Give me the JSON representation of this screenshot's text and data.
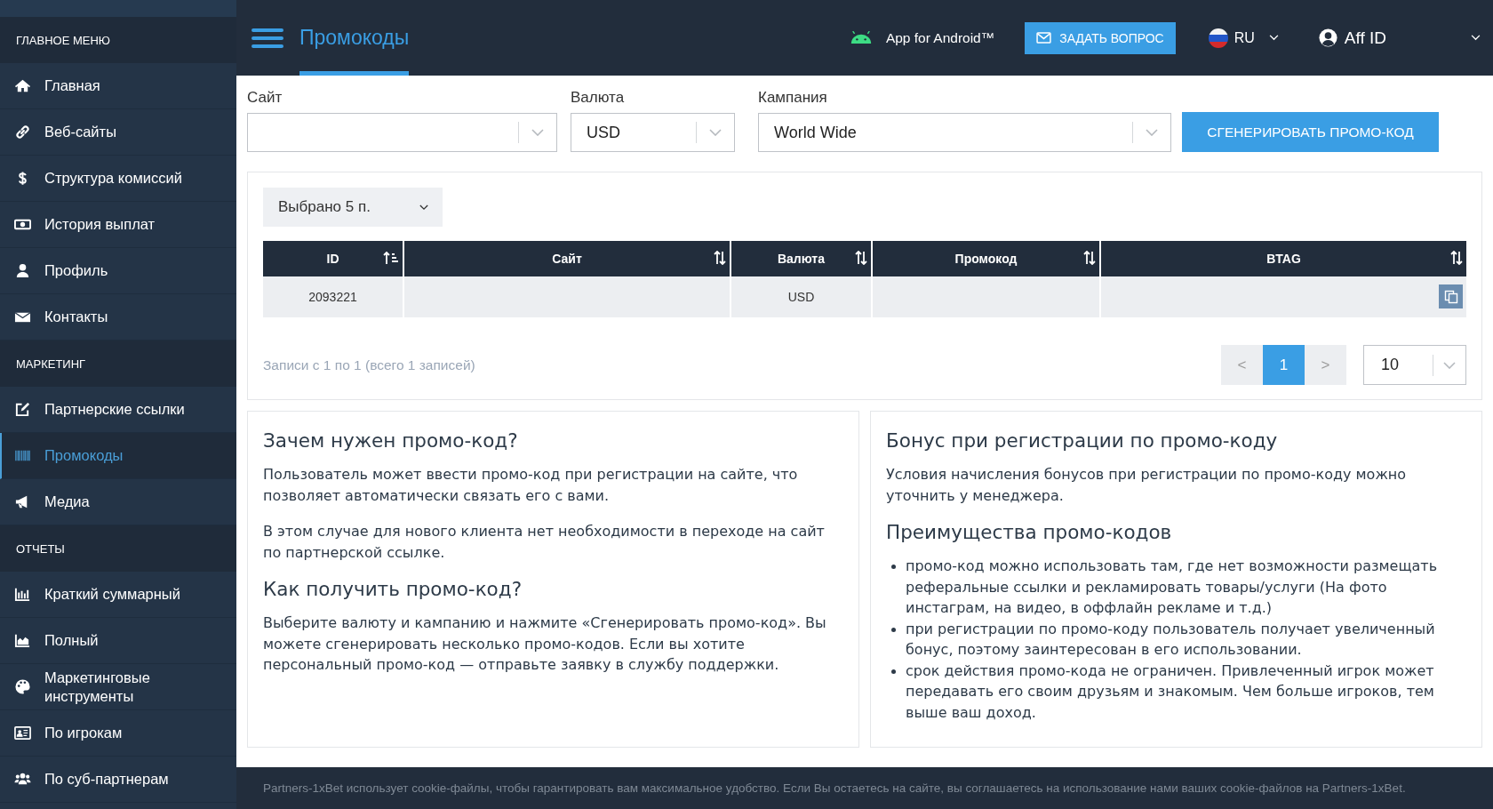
{
  "sidebar": {
    "sections": [
      {
        "title": "ГЛАВНОЕ МЕНЮ",
        "items": [
          {
            "label": "Главная",
            "kind": "home",
            "selected": false
          },
          {
            "label": "Веб-сайты",
            "kind": "link",
            "selected": false
          },
          {
            "label": "Структура комиссий",
            "kind": "dollar",
            "selected": false
          },
          {
            "label": "История выплат",
            "kind": "money",
            "selected": false
          },
          {
            "label": "Профиль",
            "kind": "user",
            "selected": false
          },
          {
            "label": "Контакты",
            "kind": "mail",
            "selected": false
          }
        ]
      },
      {
        "title": "МАРКЕТИНГ",
        "items": [
          {
            "label": "Партнерские ссылки",
            "kind": "edit",
            "selected": false
          },
          {
            "label": "Промокоды",
            "kind": "barcode",
            "selected": true
          },
          {
            "label": "Медиа",
            "kind": "megaphone",
            "selected": false
          }
        ]
      },
      {
        "title": "ОТЧЕТЫ",
        "items": [
          {
            "label": "Краткий суммарный",
            "kind": "bars",
            "selected": false
          },
          {
            "label": "Полный",
            "kind": "area",
            "selected": false
          },
          {
            "label": "Маркетинговые инструменты",
            "kind": "palette",
            "selected": false
          },
          {
            "label": "По игрокам",
            "kind": "card",
            "selected": false
          },
          {
            "label": "По суб-партнерам",
            "kind": "users",
            "selected": false
          }
        ]
      }
    ]
  },
  "header": {
    "title": "Промокоды",
    "app_link": "App for Android™",
    "ask_button": "ЗАДАТЬ ВОПРОС",
    "language": "RU",
    "user": "Aff ID"
  },
  "filters": [
    {
      "label": "Сайт"
    },
    {
      "label": "Валюта",
      "value": "USD"
    },
    {
      "label": "Кампания",
      "value": "World Wide"
    }
  ],
  "generate_button": "СГЕНЕРИРОВАТЬ ПРОМО-КОД",
  "table": {
    "column_selector": "Выбрано 5 п.",
    "columns": [
      {
        "label": "ID",
        "sorted": true
      },
      {
        "label": "Сайт",
        "sorted": false
      },
      {
        "label": "Валюта",
        "sorted": false
      },
      {
        "label": "Промокод",
        "sorted": false
      },
      {
        "label": "BTAG",
        "sorted": false
      }
    ],
    "rows": [
      {
        "cells": [
          "2093221",
          null,
          "USD",
          null,
          null
        ],
        "copy": true
      }
    ],
    "records": "Записи с 1 по 1 (всего 1 записей)",
    "pagination": {
      "prev": "<",
      "pages": [
        {
          "label": "1",
          "selected": true
        }
      ],
      "next": ">",
      "per_page": "10"
    }
  },
  "info_cards": [
    {
      "blocks": [
        {
          "kind": "heading",
          "text": "Зачем нужен промо-код?"
        },
        {
          "kind": "paragraph",
          "text": "Пользователь может ввести промо-код при регистрации на сайте, что позволяет автоматически связать его с вами."
        },
        {
          "kind": "paragraph",
          "text": "В этом случае для нового клиента нет необходимости в переходе на сайт по партнерской ссылке."
        },
        {
          "kind": "heading",
          "text": "Как получить промо-код?"
        },
        {
          "kind": "paragraph",
          "text": "Выберите валюту и кампанию и нажмите «Сгенерировать промо-код». Вы можете сгенерировать несколько промо-кодов. Если вы хотите персональный промо-код — отправьте заявку в службу поддержки."
        }
      ]
    },
    {
      "blocks": [
        {
          "kind": "heading",
          "text": "Бонус при регистрации по промо-коду"
        },
        {
          "kind": "paragraph",
          "text": "Условия начисления бонусов при регистрации по промо-коду можно уточнить у менеджера."
        },
        {
          "kind": "heading",
          "text": "Преимущества промо-кодов"
        },
        {
          "kind": "list",
          "items": [
            "промо-код можно использовать там, где нет возможности размещать реферальные ссылки и рекламировать товары/услуги (На фото инстаграм, на видео, в оффлайн рекламе и т.д.)",
            "при регистрации по промо-коду пользователь получает увеличенный бонус, поэтому заинтересован в его использовании.",
            "срок действия промо-кода не ограничен. Привлеченный игрок может передавать его своим друзьям и знакомым. Чем больше игроков, тем выше ваш доход."
          ]
        }
      ]
    }
  ],
  "footer": "Partners-1xBet использует cookie-файлы, чтобы гарантировать вам максимальное удобство. Если Вы остаетесь на сайте, вы соглашаетесь на использование нами ваших cookie-файлов на Partners-1xBet."
}
